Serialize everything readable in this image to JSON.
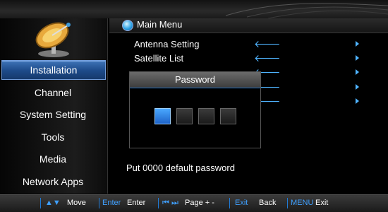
{
  "header": {
    "title": "Main Menu",
    "icon": "globe-icon"
  },
  "sidebar": {
    "icon": "satellite-dish-icon",
    "items": [
      {
        "label": "Installation",
        "active": true
      },
      {
        "label": "Channel"
      },
      {
        "label": "System Setting"
      },
      {
        "label": "Tools"
      },
      {
        "label": "Media"
      },
      {
        "label": "Network Apps"
      }
    ]
  },
  "menu": {
    "items": [
      {
        "label": "Antenna Setting",
        "arrow": "🡐"
      },
      {
        "label": "Satellite List",
        "arrow": "🡐"
      }
    ],
    "hidden_rows_arrow": "🡐"
  },
  "dialog": {
    "title": "Password",
    "digits": 4,
    "active_index": 0
  },
  "hint": "Put 0000 default password",
  "footer": {
    "move_key": "▲▼",
    "move_label": "Move",
    "enter_key": "Enter",
    "enter_label": "Enter",
    "page_keys": "⏮ ⏭",
    "page_label": "Page + -",
    "exit_key": "Exit",
    "back_label": "Back",
    "menu_key": "MENU",
    "exit_label": "Exit"
  },
  "colors": {
    "accent": "#3fa0ff",
    "active": "#1d4a88"
  }
}
